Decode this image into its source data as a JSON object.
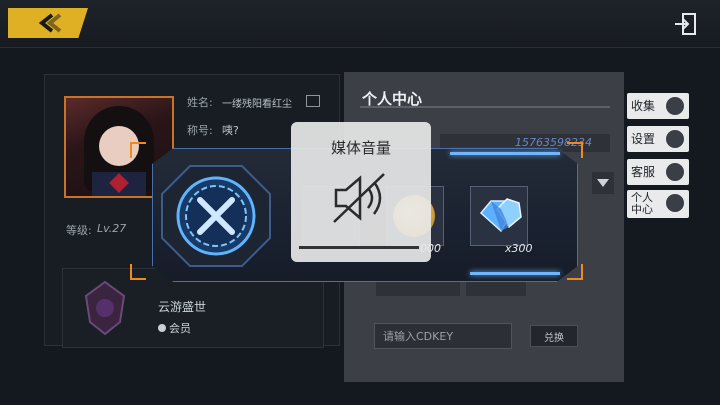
{
  "top_bar": {
    "back_icon": "back-arrow-icon",
    "exit_icon": "exit-door-icon"
  },
  "profile": {
    "name_label": "姓名:",
    "name_value": "一缕残阳看红尘",
    "title_label": "称号:",
    "title_value": "咦?",
    "level_label": "等级:",
    "level_value": "Lv.27"
  },
  "guild": {
    "name": "云游盛世",
    "role": "会员"
  },
  "personal_center": {
    "title": "个人中心",
    "id_value": "15763598234",
    "cdkey_placeholder": "请输入CDKEY",
    "redeem_label": "兑换"
  },
  "side_tabs": [
    {
      "label": "收集"
    },
    {
      "label": "设置"
    },
    {
      "label": "客服"
    },
    {
      "label": "个人中心"
    }
  ],
  "reward_dialog": {
    "rewards": [
      {
        "icon": "item-icon",
        "qty": ""
      },
      {
        "icon": "coin-icon",
        "qty": "000"
      },
      {
        "icon": "crystal-icon",
        "qty": "x300"
      }
    ]
  },
  "volume_toast": {
    "title": "媒体音量",
    "icon": "speaker-muted-icon",
    "level": 0
  },
  "colors": {
    "accent": "#e0b024",
    "frame_orange": "#f08a1f",
    "glow_blue": "#6fb6ff"
  }
}
